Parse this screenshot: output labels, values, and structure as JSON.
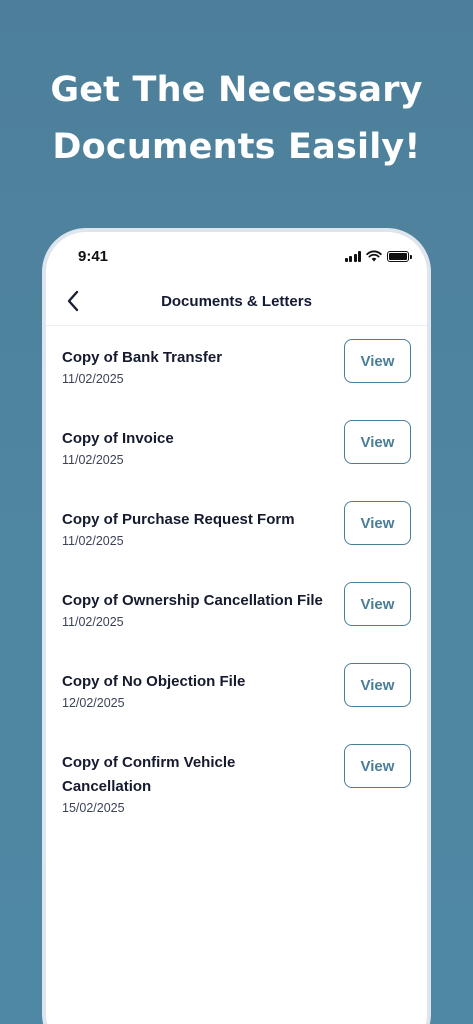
{
  "headline": {
    "line1": "Get The Necessary",
    "line2": "Documents Easily!"
  },
  "status_bar": {
    "time": "9:41",
    "icons": [
      "cellular-signal-icon",
      "wifi-icon",
      "battery-icon"
    ]
  },
  "nav": {
    "title": "Documents & Letters",
    "back_icon": "chevron-left-icon"
  },
  "documents": [
    {
      "title": "Copy of Bank Transfer",
      "date": "11/02/2025",
      "action": "View"
    },
    {
      "title": "Copy of Invoice",
      "date": "11/02/2025",
      "action": "View"
    },
    {
      "title": "Copy of Purchase Request Form",
      "date": "11/02/2025",
      "action": "View"
    },
    {
      "title": "Copy of Ownership Cancellation File",
      "date": "11/02/2025",
      "action": "View"
    },
    {
      "title": "Copy of No Objection File",
      "date": "12/02/2025",
      "action": "View"
    },
    {
      "title": "Copy of Confirm Vehicle Cancellation",
      "date": "15/02/2025",
      "action": "View"
    }
  ],
  "colors": {
    "background": "#4f86a2",
    "accent": "#4a7e98",
    "text_dark": "#151a2f"
  }
}
